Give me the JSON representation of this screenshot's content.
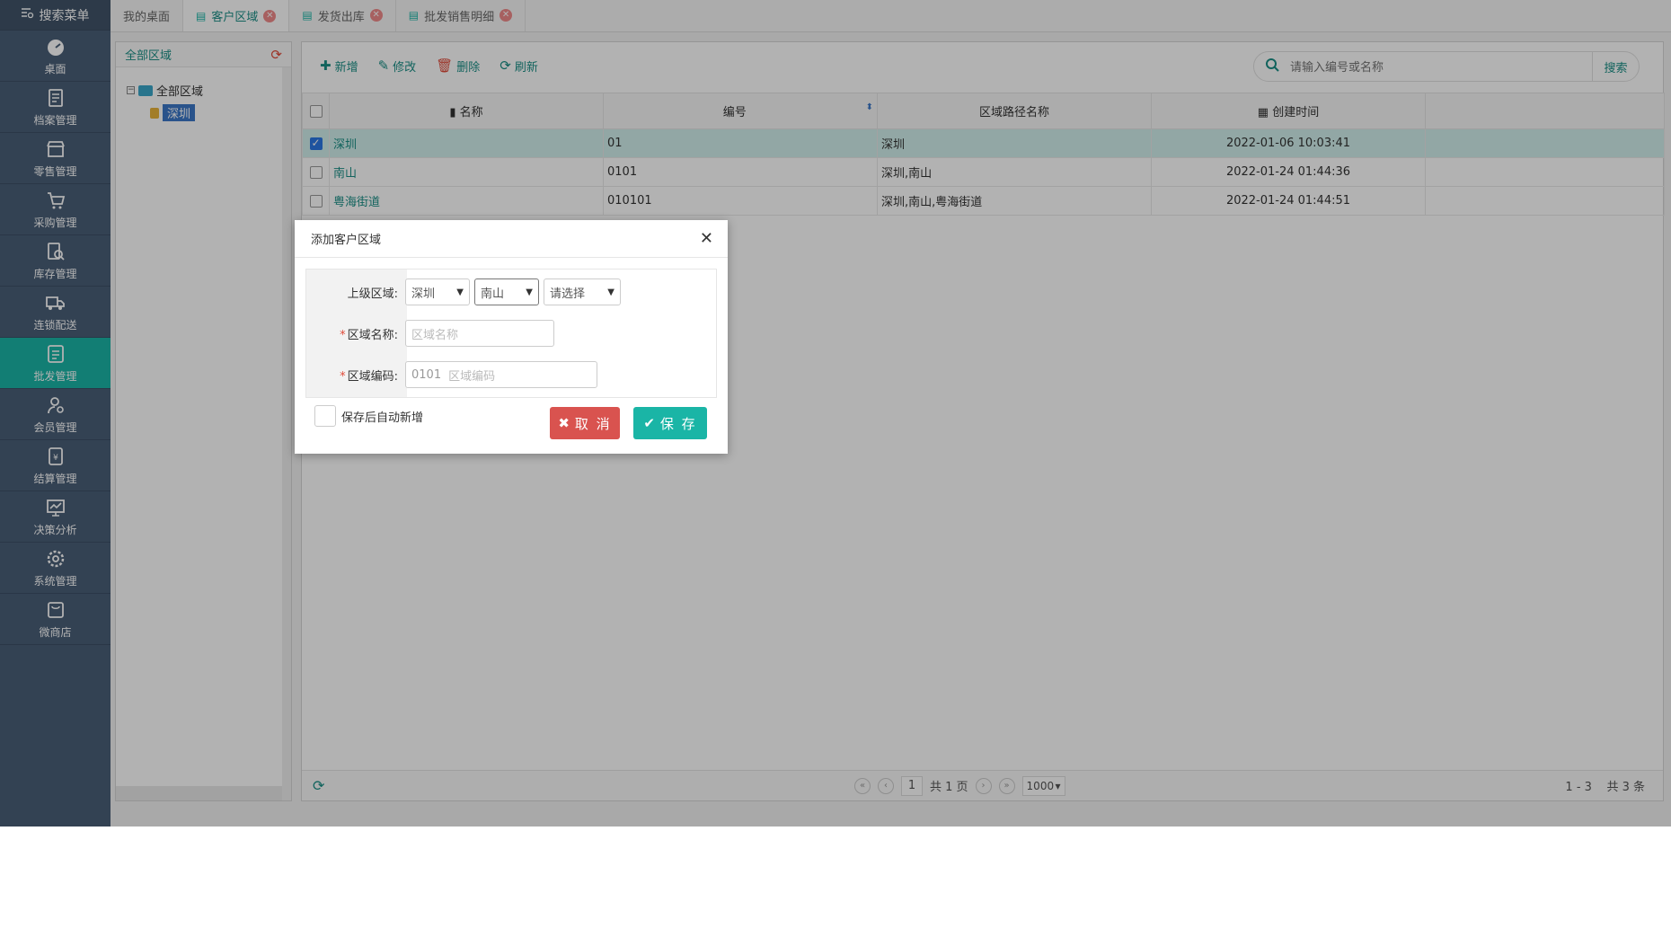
{
  "sidebar": {
    "search_menu": "搜索菜单",
    "items": [
      {
        "label": "桌面",
        "icon": "dashboard-icon"
      },
      {
        "label": "档案管理",
        "icon": "archive-icon"
      },
      {
        "label": "零售管理",
        "icon": "store-icon"
      },
      {
        "label": "采购管理",
        "icon": "purchase-icon"
      },
      {
        "label": "库存管理",
        "icon": "inventory-icon"
      },
      {
        "label": "连锁配送",
        "icon": "delivery-truck-icon"
      },
      {
        "label": "批发管理",
        "icon": "wholesale-icon",
        "active": true
      },
      {
        "label": "会员管理",
        "icon": "member-icon"
      },
      {
        "label": "结算管理",
        "icon": "settlement-icon"
      },
      {
        "label": "决策分析",
        "icon": "analysis-chart-icon"
      },
      {
        "label": "系统管理",
        "icon": "settings-gear-icon"
      },
      {
        "label": "微商店",
        "icon": "micro-shop-icon"
      }
    ]
  },
  "tabs": [
    {
      "label": "我的桌面",
      "closable": false
    },
    {
      "label": "客户区域",
      "closable": true,
      "active": true
    },
    {
      "label": "发货出库",
      "closable": true
    },
    {
      "label": "批发销售明细",
      "closable": true
    }
  ],
  "tree": {
    "title": "全部区域",
    "root": "全部区域",
    "child": "深圳"
  },
  "toolbar": {
    "add": "新增",
    "edit": "修改",
    "delete": "删除",
    "refresh": "刷新"
  },
  "search": {
    "placeholder": "请输入编号或名称",
    "button": "搜索"
  },
  "table": {
    "headers": [
      "名称",
      "编号",
      "区域路径名称",
      "创建时间"
    ],
    "rows": [
      {
        "name": "深圳",
        "code": "01",
        "path": "深圳",
        "created": "2022-01-06 10:03:41",
        "checked": true
      },
      {
        "name": "南山",
        "code": "0101",
        "path": "深圳,南山",
        "created": "2022-01-24 01:44:36",
        "checked": false
      },
      {
        "name": "粤海街道",
        "code": "010101",
        "path": "深圳,南山,粤海街道",
        "created": "2022-01-24 01:44:51",
        "checked": false
      }
    ]
  },
  "pager": {
    "page": "1",
    "total_pages": "共 1 页",
    "page_size": "1000",
    "count_range": "1 - 3",
    "count_total": "共 3 条"
  },
  "dialog": {
    "title": "添加客户区域",
    "parent_label": "上级区域:",
    "parent_sel1": "深圳",
    "parent_sel2": "南山",
    "parent_sel3": "请选择",
    "name_label": "区域名称:",
    "name_placeholder": "区域名称",
    "code_label": "区域编码:",
    "code_prefix": "0101",
    "code_placeholder": "区域编码",
    "auto_add": "保存后自动新增",
    "cancel": "取 消",
    "save": "保 存"
  },
  "colors": {
    "accent": "#1ab5a6",
    "sidebar": "#4a5f78",
    "danger": "#d9534f"
  }
}
